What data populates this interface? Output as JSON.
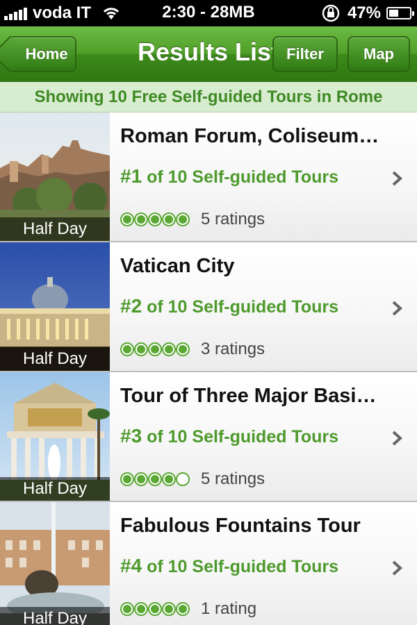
{
  "status_bar": {
    "carrier": "voda IT",
    "time_memory": "2:30 - 28MB",
    "battery": "47%",
    "battery_level": 0.47
  },
  "nav": {
    "title": "Results List",
    "home_label": "Home",
    "filter_label": "Filter",
    "map_label": "Map"
  },
  "subtitle": "Showing 10 Free Self-guided Tours in Rome",
  "results": [
    {
      "title": "Roman Forum, Coliseum…",
      "rank": "#1",
      "rank_suffix": " of 10 Self-guided Tours",
      "duration": "Half Day",
      "rating": 5,
      "ratings_text": "5 ratings"
    },
    {
      "title": "Vatican City",
      "rank": "#2",
      "rank_suffix": " of 10 Self-guided Tours",
      "duration": "Half Day",
      "rating": 5,
      "ratings_text": "3 ratings"
    },
    {
      "title": "Tour of Three Major Basi…",
      "rank": "#3",
      "rank_suffix": " of 10 Self-guided Tours",
      "duration": "Half Day",
      "rating": 4,
      "ratings_text": "5 ratings"
    },
    {
      "title": "Fabulous Fountains Tour",
      "rank": "#4",
      "rank_suffix": " of 10 Self-guided Tours",
      "duration": "Half Day",
      "rating": 5,
      "ratings_text": "1 rating"
    }
  ],
  "colors": {
    "nav_green": "#4f9e28",
    "accent_green": "#4e9a2d",
    "subtitle_bg": "#d8ecd0"
  }
}
